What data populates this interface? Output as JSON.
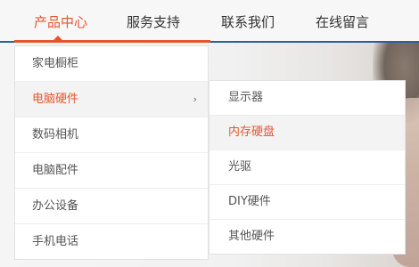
{
  "nav": {
    "items": [
      {
        "label": "产品中心",
        "active": true
      },
      {
        "label": "服务支持"
      },
      {
        "label": "联系我们"
      },
      {
        "label": "在线留言"
      }
    ]
  },
  "menu": {
    "items": [
      {
        "label": "家电橱柜"
      },
      {
        "label": "电脑硬件",
        "hover": true,
        "has_submenu": true,
        "arrow": "›"
      },
      {
        "label": "数码相机"
      },
      {
        "label": "电脑配件"
      },
      {
        "label": "办公设备"
      },
      {
        "label": "手机电话"
      }
    ]
  },
  "submenu": {
    "items": [
      {
        "label": "显示器"
      },
      {
        "label": "内存硬盘",
        "hover": true
      },
      {
        "label": "光驱"
      },
      {
        "label": "DIY硬件"
      },
      {
        "label": "其他硬件"
      }
    ]
  },
  "colors": {
    "accent": "#e4572e",
    "nav_border": "#2e5ba8",
    "text": "#555555"
  }
}
